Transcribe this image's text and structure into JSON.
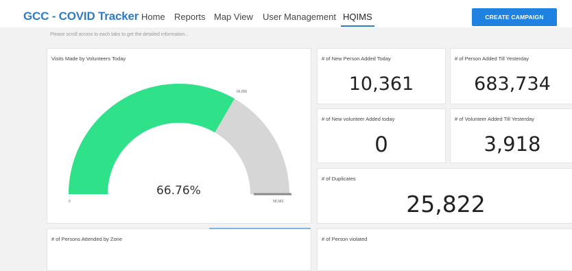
{
  "header": {
    "brand": "GCC - COVID Tracker",
    "nav": [
      "Home",
      "Reports",
      "Map View",
      "User Management",
      "HQIMS"
    ],
    "active_nav": "HQIMS",
    "create_button": "CREATE CAMPAIGN"
  },
  "hint": "Please scroll across to each tabs to get the detailed information...",
  "gauge_card": {
    "title": "Visits Made by Volunteers Today",
    "percent_text": "66.76%",
    "value_label": "66,856",
    "min_label": "0",
    "max_label": "58,942",
    "fill_fraction": 0.6676,
    "colors": {
      "fill": "#2fe28a",
      "track": "#d6d6d6",
      "target": "#8a8a8a"
    }
  },
  "kpis": {
    "new_person_today": {
      "title": "# of New Person Added Today",
      "value": "10,361"
    },
    "person_till_yesterday": {
      "title": "# of Person Added Till Yesterday",
      "value": "683,734"
    },
    "new_volunteer_today": {
      "title": "# of New volunteer Added today",
      "value": "0"
    },
    "volunteer_till_yesterday": {
      "title": "# of Volunteer Added Till Yesterday",
      "value": "3,918"
    },
    "duplicates": {
      "title": "# of Duplicates",
      "value": "25,822"
    }
  },
  "bottom": {
    "zone_title": "# of Persons Attended by Zone",
    "violated_title": "# of Person violated"
  }
}
